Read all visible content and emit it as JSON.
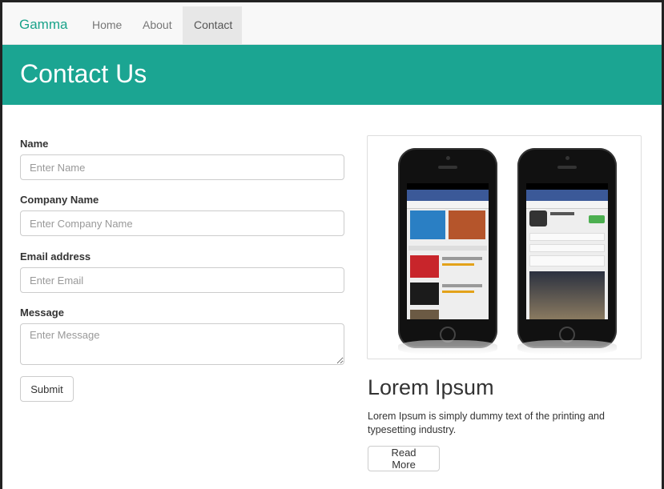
{
  "navbar": {
    "brand": "Gamma",
    "links": [
      {
        "label": "Home"
      },
      {
        "label": "About"
      },
      {
        "label": "Contact",
        "active": true
      }
    ]
  },
  "header": {
    "title": "Contact Us"
  },
  "form": {
    "fields": [
      {
        "label": "Name",
        "placeholder": "Enter Name",
        "value": ""
      },
      {
        "label": "Company Name",
        "placeholder": "Enter Company Name",
        "value": ""
      },
      {
        "label": "Email address",
        "placeholder": "Enter Email",
        "value": ""
      },
      {
        "label": "Message",
        "placeholder": "Enter Message",
        "value": ""
      }
    ],
    "submit_label": "Submit"
  },
  "card": {
    "title": "Lorem Ipsum",
    "text": "Lorem Ipsum is simply dummy text of the printing and typesetting industry.",
    "button_label": "Read More"
  },
  "colors": {
    "accent": "#1ba592",
    "brand_text": "#1aa38a",
    "navbar_bg": "#f8f8f8"
  }
}
